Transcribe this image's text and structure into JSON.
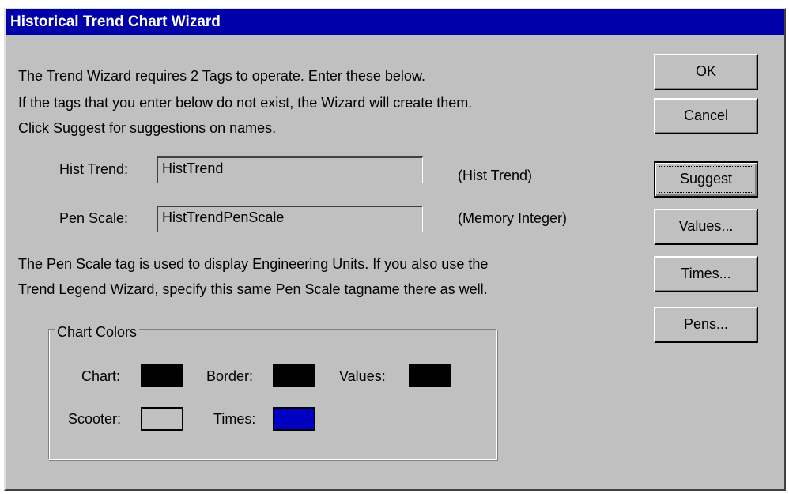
{
  "title": "Historical Trend Chart Wizard",
  "intro": {
    "line1": "The Trend Wizard requires 2 Tags to operate.  Enter these below.",
    "line2": "If the tags that you enter below do not exist, the Wizard will create them.",
    "line3": "Click Suggest for suggestions on names."
  },
  "fields": {
    "hist_trend": {
      "label": "Hist Trend:",
      "value": "HistTrend",
      "type": "(Hist Trend)"
    },
    "pen_scale": {
      "label": "Pen Scale:",
      "value": "HistTrendPenScale",
      "type": "(Memory Integer)"
    }
  },
  "note": {
    "line1": "The Pen Scale tag is used to display Engineering Units.  If you also use the",
    "line2": "Trend Legend Wizard, specify this same Pen Scale tagname there as well."
  },
  "chart_colors": {
    "legend": "Chart Colors",
    "chart": {
      "label": "Chart:",
      "color": "#000000"
    },
    "border": {
      "label": "Border:",
      "color": "#000000"
    },
    "values": {
      "label": "Values:",
      "color": "#000000"
    },
    "scooter": {
      "label": "Scooter:",
      "color": "#c0c0c0"
    },
    "times": {
      "label": "Times:",
      "color": "#0000c0"
    }
  },
  "buttons": {
    "ok": "OK",
    "cancel": "Cancel",
    "suggest": "Suggest",
    "values": "Values...",
    "times": "Times...",
    "pens": "Pens..."
  },
  "colors": {
    "titlebar": "#0000a8",
    "face": "#c0c0c0"
  }
}
